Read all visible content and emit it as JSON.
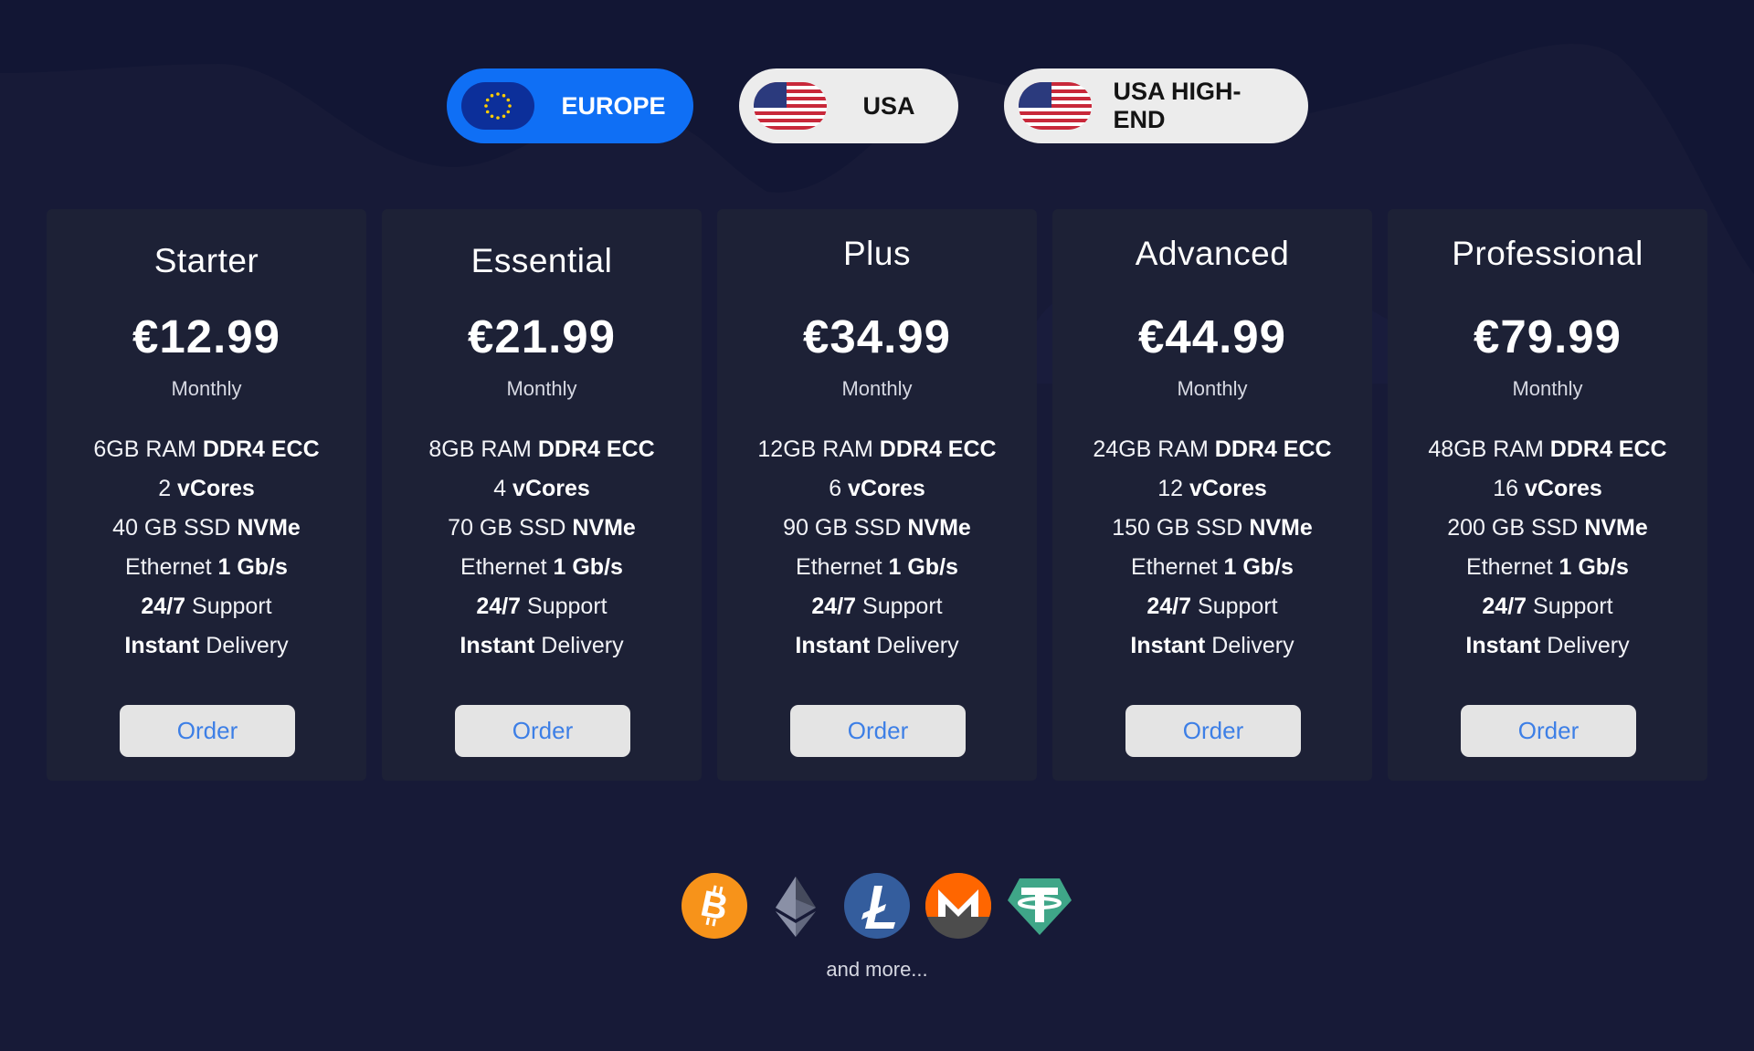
{
  "regions": {
    "europe_label": "EUROPE",
    "usa_label": "USA",
    "usa_highend_label": "USA HIGH-END",
    "active": "EUROPE"
  },
  "plans": [
    {
      "name": "Starter",
      "price": "€12.99",
      "period": "Monthly",
      "ram_amount": "6GB RAM",
      "ram_type": "DDR4 ECC",
      "cores_count": "2",
      "cores_label": "vCores",
      "storage_amount": "40 GB SSD",
      "storage_type": "NVMe",
      "network_label": "Ethernet",
      "network_speed": "1 Gb/s",
      "support_hours": "24/7",
      "support_label": "Support",
      "delivery_speed": "Instant",
      "delivery_label": "Delivery",
      "order_label": "Order"
    },
    {
      "name": "Essential",
      "price": "€21.99",
      "period": "Monthly",
      "ram_amount": "8GB RAM",
      "ram_type": "DDR4 ECC",
      "cores_count": "4",
      "cores_label": "vCores",
      "storage_amount": "70 GB SSD",
      "storage_type": "NVMe",
      "network_label": "Ethernet",
      "network_speed": "1 Gb/s",
      "support_hours": "24/7",
      "support_label": "Support",
      "delivery_speed": "Instant",
      "delivery_label": "Delivery",
      "order_label": "Order"
    },
    {
      "name": "Plus",
      "price": "€34.99",
      "period": "Monthly",
      "ram_amount": "12GB RAM",
      "ram_type": "DDR4 ECC",
      "cores_count": "6",
      "cores_label": "vCores",
      "storage_amount": "90 GB SSD",
      "storage_type": "NVMe",
      "network_label": "Ethernet",
      "network_speed": "1 Gb/s",
      "support_hours": "24/7",
      "support_label": "Support",
      "delivery_speed": "Instant",
      "delivery_label": "Delivery",
      "order_label": "Order"
    },
    {
      "name": "Advanced",
      "price": "€44.99",
      "period": "Monthly",
      "ram_amount": "24GB RAM",
      "ram_type": "DDR4 ECC",
      "cores_count": "12",
      "cores_label": "vCores",
      "storage_amount": "150 GB SSD",
      "storage_type": "NVMe",
      "network_label": "Ethernet",
      "network_speed": "1 Gb/s",
      "support_hours": "24/7",
      "support_label": "Support",
      "delivery_speed": "Instant",
      "delivery_label": "Delivery",
      "order_label": "Order"
    },
    {
      "name": "Professional",
      "price": "€79.99",
      "period": "Monthly",
      "ram_amount": "48GB RAM",
      "ram_type": "DDR4 ECC",
      "cores_count": "16",
      "cores_label": "vCores",
      "storage_amount": "200 GB SSD",
      "storage_type": "NVMe",
      "network_label": "Ethernet",
      "network_speed": "1 Gb/s",
      "support_hours": "24/7",
      "support_label": "Support",
      "delivery_speed": "Instant",
      "delivery_label": "Delivery",
      "order_label": "Order"
    }
  ],
  "payments": {
    "icons": [
      "bitcoin-icon",
      "ethereum-icon",
      "litecoin-icon",
      "monero-icon",
      "tether-icon"
    ],
    "more_text": "and more..."
  },
  "colors": {
    "background": "#171a37",
    "card": "#1d2136",
    "active_pill": "#0f6ff5",
    "order_text": "#3d7fe6"
  }
}
